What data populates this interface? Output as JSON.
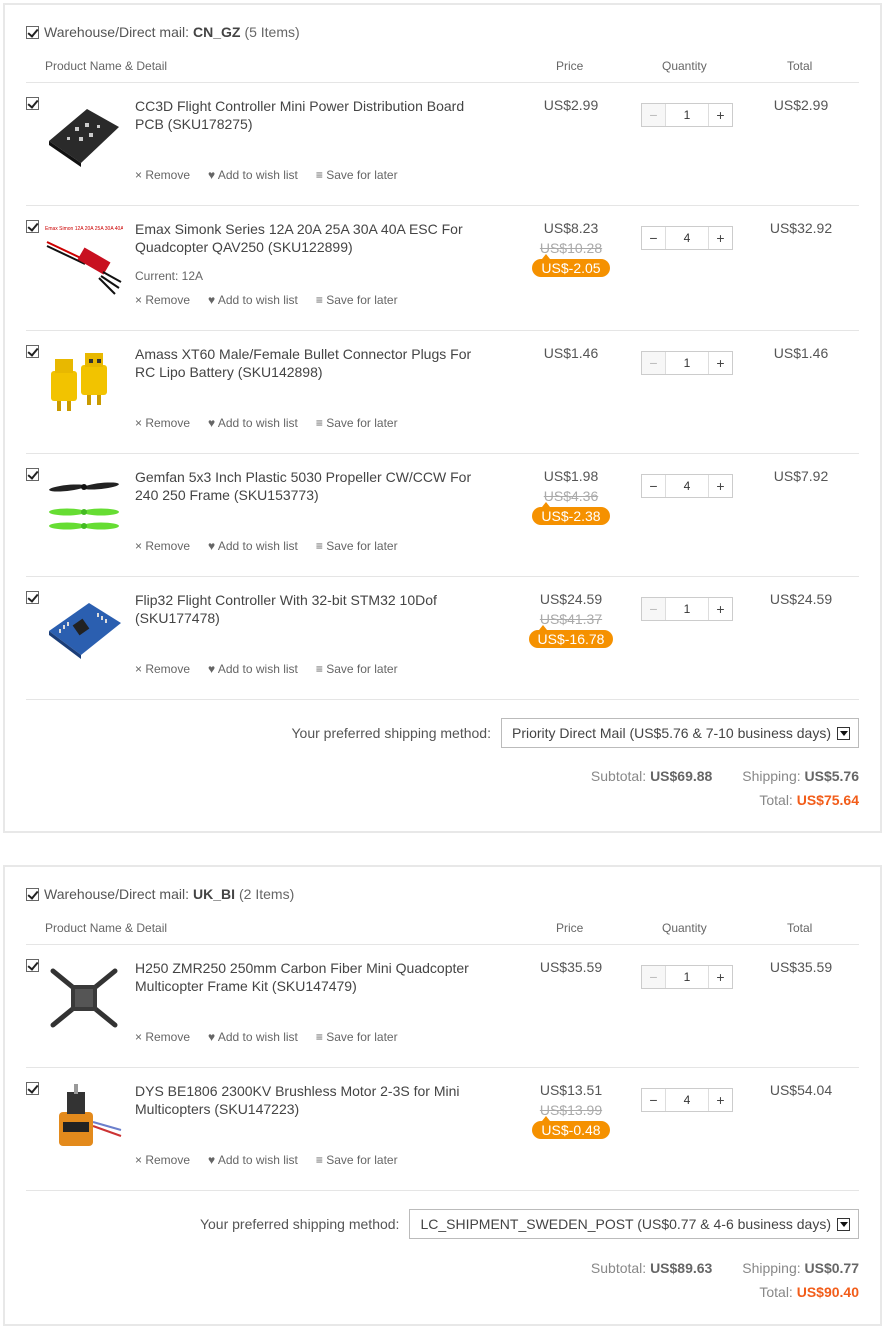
{
  "columns": {
    "product": "Product Name & Detail",
    "price": "Price",
    "quantity": "Quantity",
    "total": "Total"
  },
  "actions": {
    "remove": "× Remove",
    "wish": "♥ Add to wish list",
    "save": "≡ Save for later"
  },
  "shipping_label": "Your preferred shipping method:",
  "subtotal_label": "Subtotal:",
  "shipping_cost_label": "Shipping:",
  "total_label": "Total:",
  "warehouses": [
    {
      "label": "Warehouse/Direct mail:",
      "code": "CN_GZ",
      "count": "(5 Items)",
      "items": [
        {
          "name": "CC3D Flight Controller Mini Power Distribution Board PCB (SKU178275)",
          "price": "US$2.99",
          "qty": "1",
          "total": "US$2.99"
        },
        {
          "name": "Emax Simonk Series 12A 20A 25A 30A 40A ESC For Quadcopter QAV250 (SKU122899)",
          "variant": "Current: 12A",
          "price": "US$8.23",
          "old_price": "US$10.28",
          "discount": "US$-2.05",
          "qty": "4",
          "total": "US$32.92"
        },
        {
          "name": "Amass XT60 Male/Female Bullet Connector Plugs For RC Lipo Battery (SKU142898)",
          "price": "US$1.46",
          "qty": "1",
          "total": "US$1.46"
        },
        {
          "name": "Gemfan 5x3 Inch Plastic 5030 Propeller CW/CCW For 240 250 Frame (SKU153773)",
          "price": "US$1.98",
          "old_price": "US$4.36",
          "discount": "US$-2.38",
          "qty": "4",
          "total": "US$7.92"
        },
        {
          "name": "Flip32 Flight Controller With 32-bit STM32 10Dof (SKU177478)",
          "price": "US$24.59",
          "old_price": "US$41.37",
          "discount": "US$-16.78",
          "qty": "1",
          "total": "US$24.59"
        }
      ],
      "shipping_method": "Priority Direct Mail (US$5.76 & 7-10 business days)",
      "subtotal": "US$69.88",
      "shipping": "US$5.76",
      "total": "US$75.64"
    },
    {
      "label": "Warehouse/Direct mail:",
      "code": "UK_BI",
      "count": "(2 Items)",
      "items": [
        {
          "name": "H250 ZMR250 250mm Carbon Fiber Mini Quadcopter Multicopter Frame Kit (SKU147479)",
          "price": "US$35.59",
          "qty": "1",
          "total": "US$35.59"
        },
        {
          "name": "DYS BE1806 2300KV Brushless Motor 2-3S for Mini Multicopters (SKU147223)",
          "price": "US$13.51",
          "old_price": "US$13.99",
          "discount": "US$-0.48",
          "qty": "4",
          "total": "US$54.04"
        }
      ],
      "shipping_method": "LC_SHIPMENT_SWEDEN_POST (US$0.77 & 4-6 business days)",
      "subtotal": "US$89.63",
      "shipping": "US$0.77",
      "total": "US$90.40"
    }
  ]
}
